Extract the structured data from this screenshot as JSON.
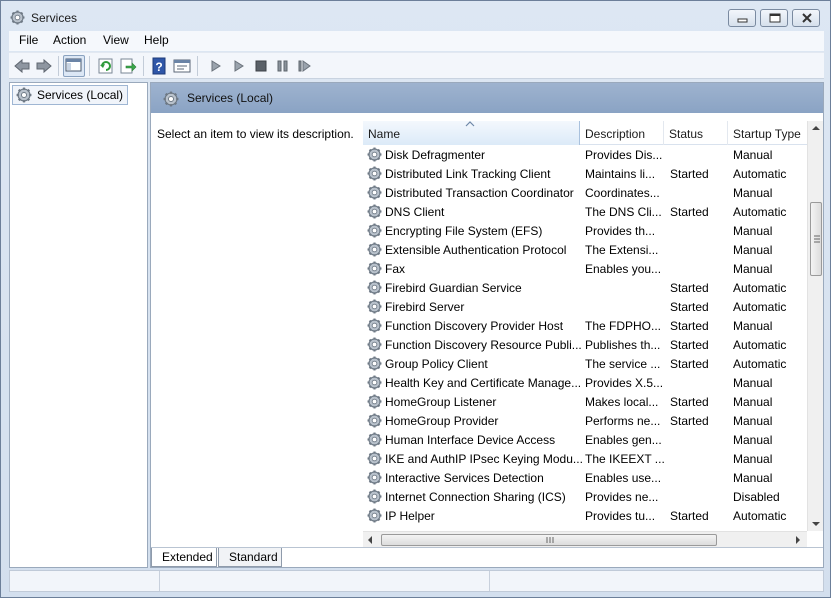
{
  "window": {
    "title": "Services"
  },
  "menu": [
    "File",
    "Action",
    "View",
    "Help"
  ],
  "toolbar": {
    "icons": [
      "back-arrow-icon",
      "forward-arrow-icon",
      "show-hide-console-tree-icon",
      "refresh-icon",
      "export-list-icon",
      "help-icon",
      "properties-icon",
      "start-service-icon",
      "start-service-alt-icon",
      "stop-service-icon",
      "pause-service-icon",
      "restart-service-icon"
    ]
  },
  "tree": {
    "root_label": "Services (Local)"
  },
  "panel": {
    "title": "Services (Local)",
    "description_prompt": "Select an item to view its description."
  },
  "table": {
    "columns": [
      "Name",
      "Description",
      "Status",
      "Startup Type"
    ],
    "rows": [
      {
        "name": "Disk Defragmenter",
        "description": "Provides Dis...",
        "status": "",
        "startup": "Manual"
      },
      {
        "name": "Distributed Link Tracking Client",
        "description": "Maintains li...",
        "status": "Started",
        "startup": "Automatic"
      },
      {
        "name": "Distributed Transaction Coordinator",
        "description": "Coordinates...",
        "status": "",
        "startup": "Manual"
      },
      {
        "name": "DNS Client",
        "description": "The DNS Cli...",
        "status": "Started",
        "startup": "Automatic"
      },
      {
        "name": "Encrypting File System (EFS)",
        "description": "Provides th...",
        "status": "",
        "startup": "Manual"
      },
      {
        "name": "Extensible Authentication Protocol",
        "description": "The Extensi...",
        "status": "",
        "startup": "Manual"
      },
      {
        "name": "Fax",
        "description": "Enables you...",
        "status": "",
        "startup": "Manual"
      },
      {
        "name": "Firebird Guardian Service",
        "description": "",
        "status": "Started",
        "startup": "Automatic"
      },
      {
        "name": "Firebird Server",
        "description": "",
        "status": "Started",
        "startup": "Automatic"
      },
      {
        "name": "Function Discovery Provider Host",
        "description": "The FDPHO...",
        "status": "Started",
        "startup": "Manual"
      },
      {
        "name": "Function Discovery Resource Publi...",
        "description": "Publishes th...",
        "status": "Started",
        "startup": "Automatic"
      },
      {
        "name": "Group Policy Client",
        "description": "The service ...",
        "status": "Started",
        "startup": "Automatic"
      },
      {
        "name": "Health Key and Certificate Manage...",
        "description": "Provides X.5...",
        "status": "",
        "startup": "Manual"
      },
      {
        "name": "HomeGroup Listener",
        "description": "Makes local...",
        "status": "Started",
        "startup": "Manual"
      },
      {
        "name": "HomeGroup Provider",
        "description": "Performs ne...",
        "status": "Started",
        "startup": "Manual"
      },
      {
        "name": "Human Interface Device Access",
        "description": "Enables gen...",
        "status": "",
        "startup": "Manual"
      },
      {
        "name": "IKE and AuthIP IPsec Keying Modu...",
        "description": "The IKEEXT ...",
        "status": "",
        "startup": "Manual"
      },
      {
        "name": "Interactive Services Detection",
        "description": "Enables use...",
        "status": "",
        "startup": "Manual"
      },
      {
        "name": "Internet Connection Sharing (ICS)",
        "description": "Provides ne...",
        "status": "",
        "startup": "Disabled"
      },
      {
        "name": "IP Helper",
        "description": "Provides tu...",
        "status": "Started",
        "startup": "Automatic"
      }
    ]
  },
  "tabs": [
    "Extended",
    "Standard"
  ],
  "colors": {
    "panel_header": "#8aa3c4",
    "window_frame": "#d3dfee",
    "selection_border": "#9fb6d3"
  }
}
